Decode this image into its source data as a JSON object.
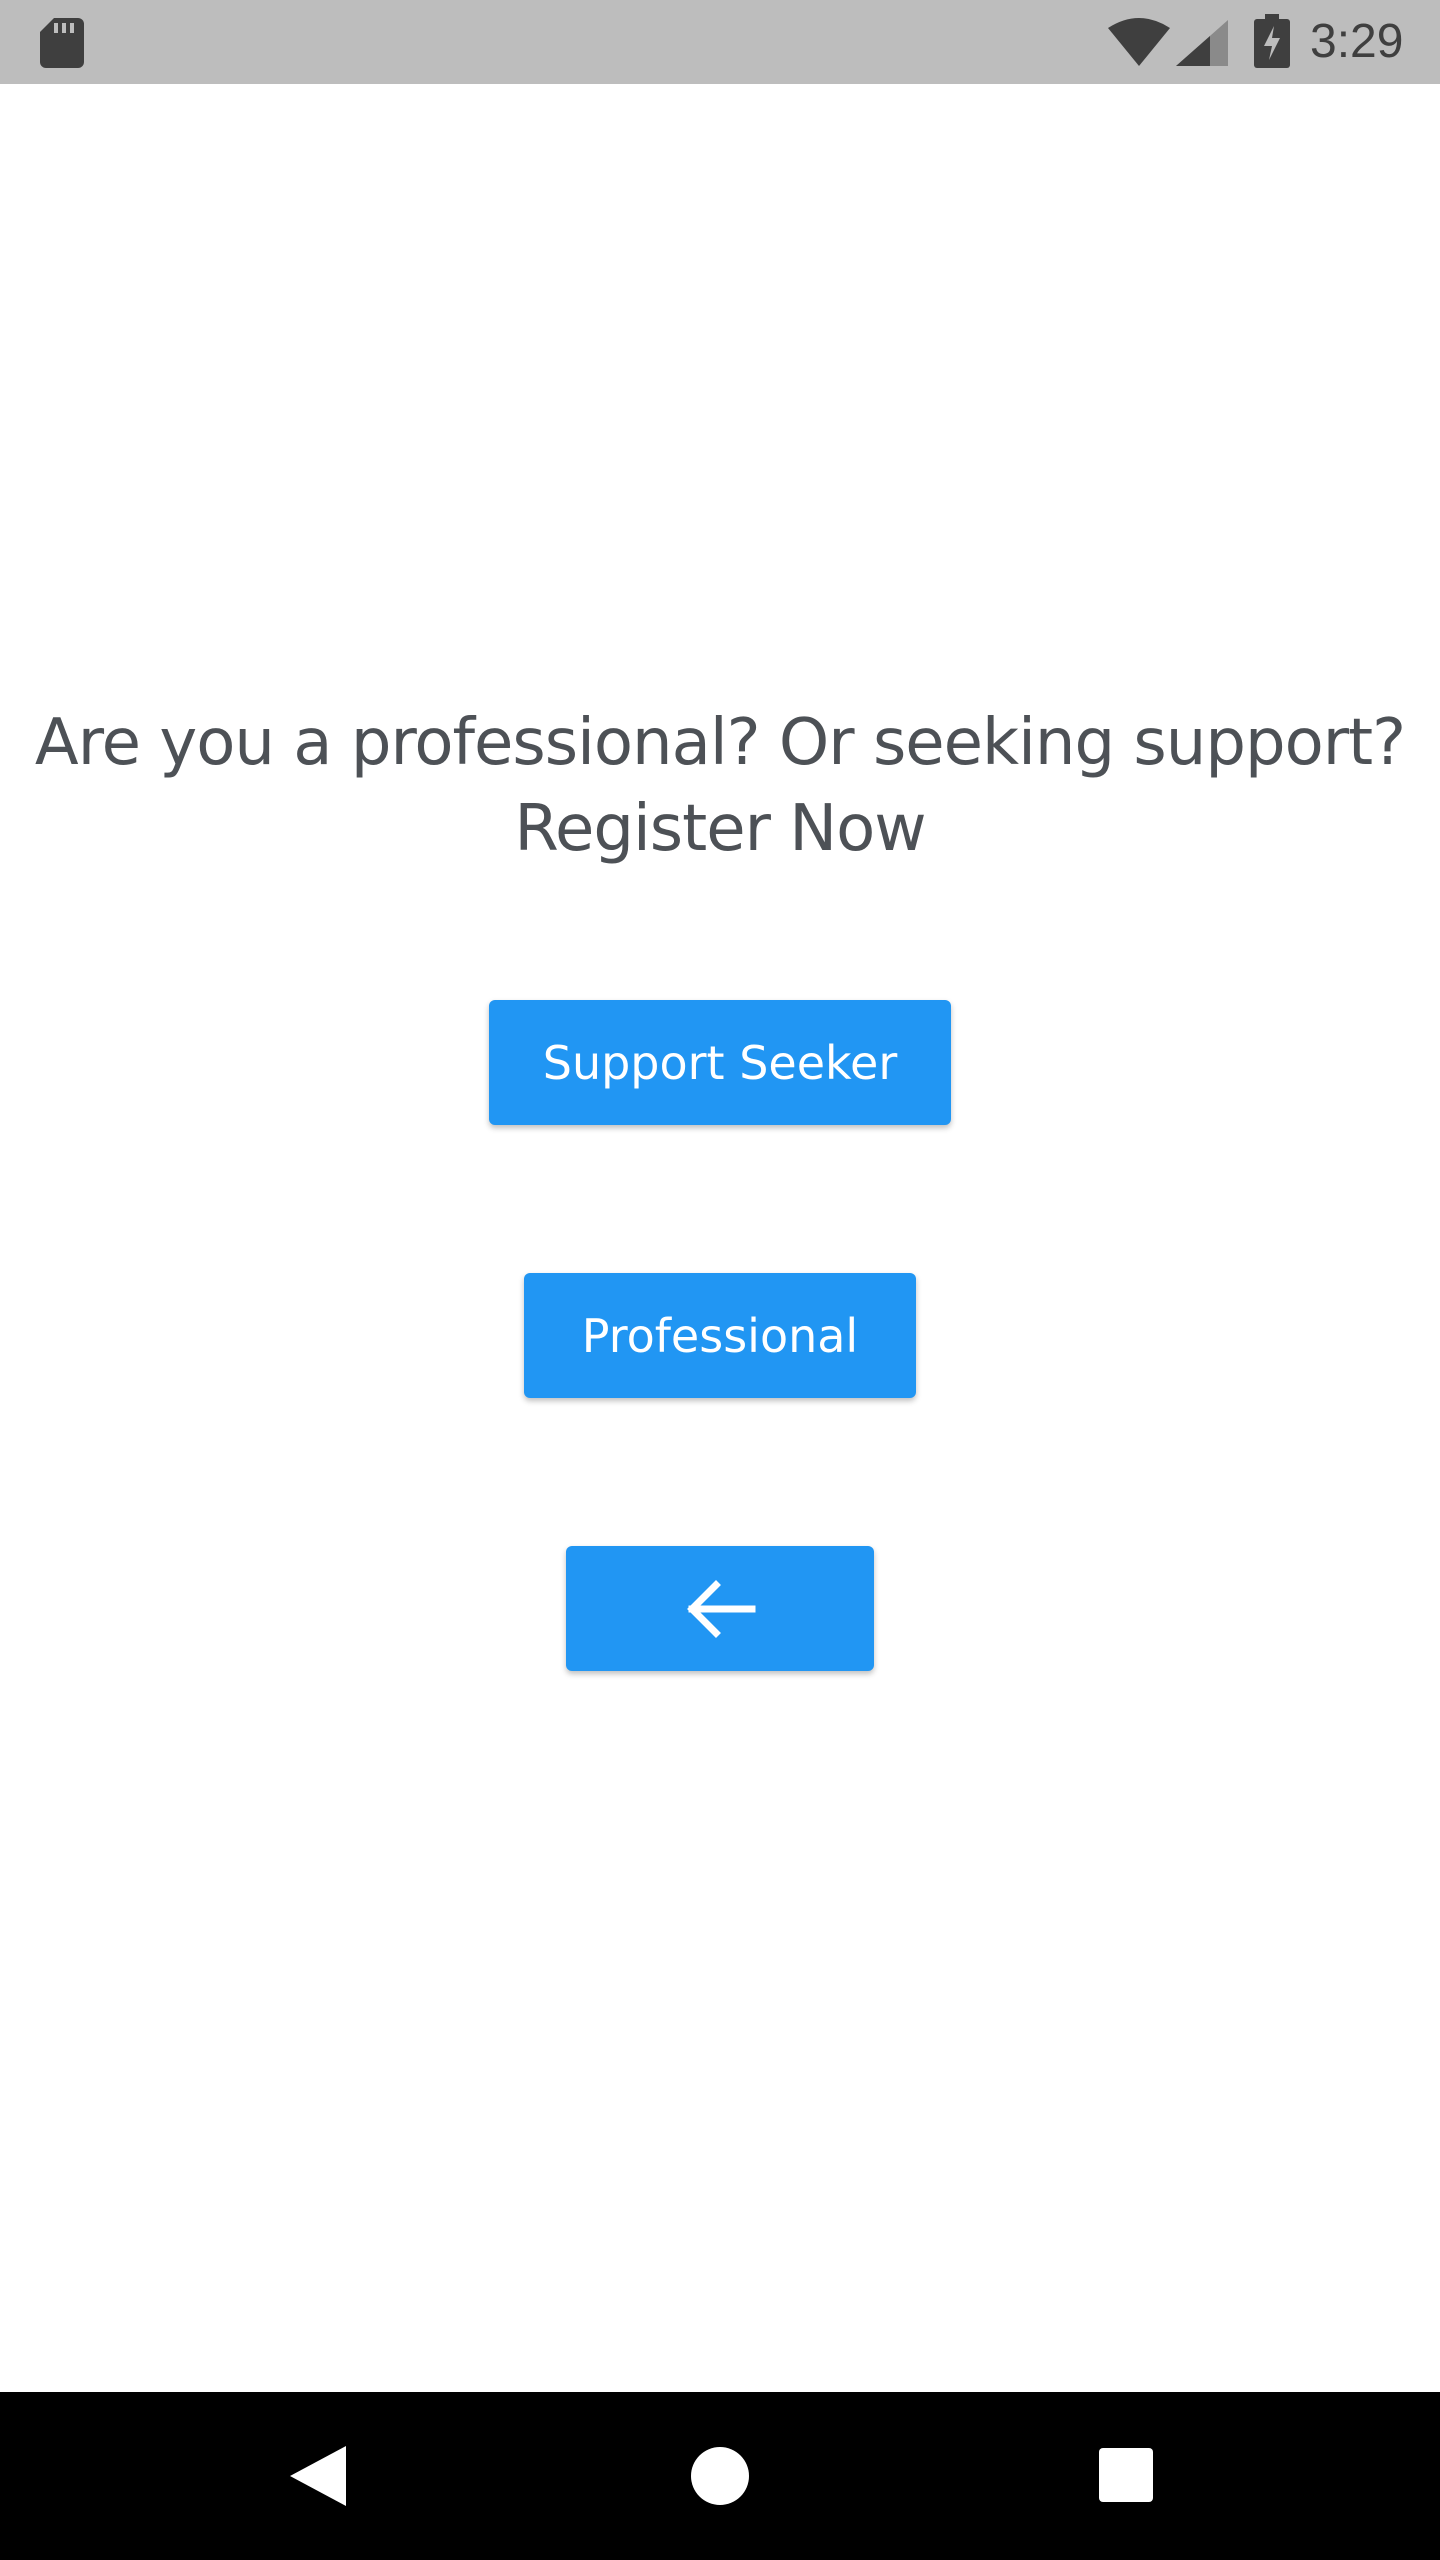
{
  "status_bar": {
    "time": "3:29",
    "icons": [
      "sd-card-icon",
      "wifi-icon",
      "signal-icon",
      "battery-charging-icon"
    ]
  },
  "prompt": {
    "line1": "Are you a professional? Or seeking support?",
    "line2": "Register Now"
  },
  "buttons": {
    "support_seeker": "Support Seeker",
    "professional": "Professional",
    "back_icon": "arrow-left-icon"
  },
  "nav_bar": {
    "icons": [
      "back-triangle-icon",
      "home-circle-icon",
      "recents-square-icon"
    ]
  },
  "colors": {
    "status_bar": "#bdbdbd",
    "button": "#2196f3",
    "text": "#4d5156",
    "nav_bar": "#000000"
  }
}
